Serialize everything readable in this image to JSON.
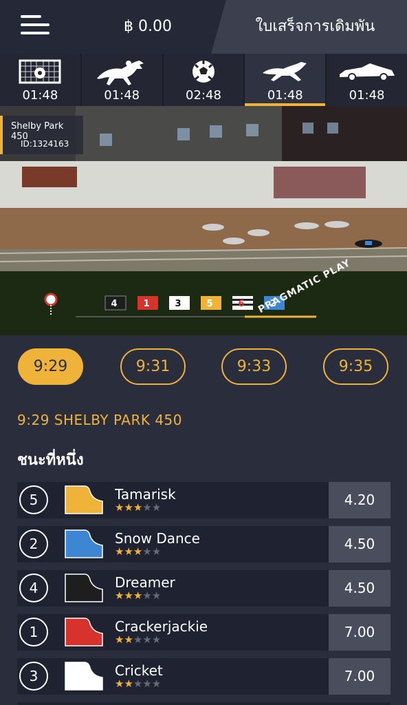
{
  "header": {
    "balance": "฿ 0.00",
    "bet_slip_label": "ใบเสร็จการเดิมพัน"
  },
  "colors": {
    "accent": "#f0b33a",
    "background": "#2a2d3c",
    "row": "#1f2230",
    "odds": "#4a4d5c"
  },
  "tabs": [
    {
      "icon": "goal-icon",
      "time": "01:48"
    },
    {
      "icon": "horse-racing-icon",
      "time": "01:48"
    },
    {
      "icon": "football-icon",
      "time": "02:48"
    },
    {
      "icon": "greyhound-icon",
      "time": "01:48",
      "active": true
    },
    {
      "icon": "motor-racing-icon",
      "time": "01:48"
    }
  ],
  "video": {
    "event_name": "Shelby Park 450",
    "event_id": "ID:1324163",
    "watermark": "PRAGMATIC PLAY",
    "positions": [
      "4",
      "1",
      "3",
      "5",
      "6",
      "2"
    ]
  },
  "race_times": [
    {
      "label": "9:29",
      "active": true
    },
    {
      "label": "9:31"
    },
    {
      "label": "9:33"
    },
    {
      "label": "9:35"
    }
  ],
  "race_title": "9:29 SHELBY PARK 450",
  "market_label": "ชนะที่หนึ่ง",
  "runners": [
    {
      "trap": "5",
      "name": "Tamarisk",
      "rating": 2.5,
      "odds": "4.20",
      "silk": "#f0b33a"
    },
    {
      "trap": "2",
      "name": "Snow Dance",
      "rating": 2.5,
      "odds": "4.50",
      "silk": "#3d86d4"
    },
    {
      "trap": "4",
      "name": "Dreamer",
      "rating": 2.5,
      "odds": "4.50",
      "silk": "#1e1e1e"
    },
    {
      "trap": "1",
      "name": "Crackerjackie",
      "rating": 1.5,
      "odds": "7.00",
      "silk": "#d8322c"
    },
    {
      "trap": "3",
      "name": "Cricket",
      "rating": 1.5,
      "odds": "7.00",
      "silk": "#ffffff"
    }
  ]
}
